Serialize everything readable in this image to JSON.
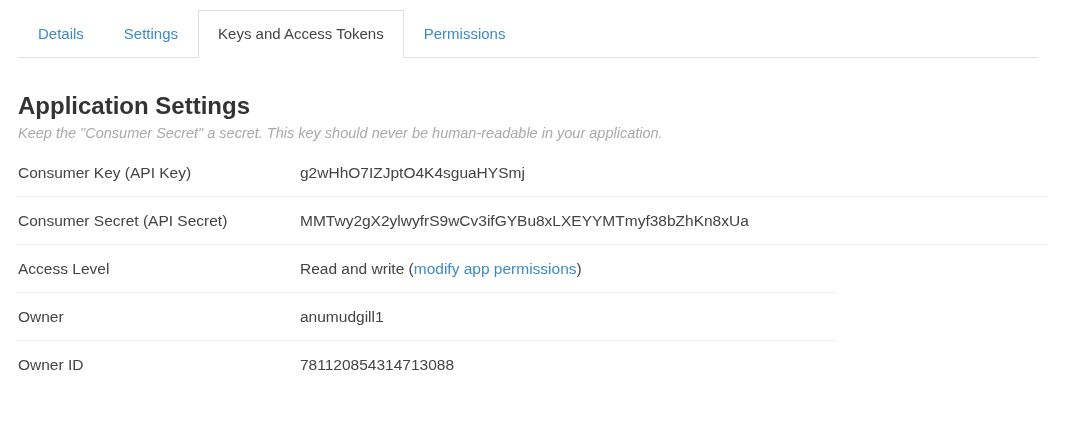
{
  "tabs": [
    {
      "label": "Details",
      "selected": false
    },
    {
      "label": "Settings",
      "selected": false
    },
    {
      "label": "Keys and Access Tokens",
      "selected": true
    },
    {
      "label": "Permissions",
      "selected": false
    }
  ],
  "heading": "Application Settings",
  "note": "Keep the \"Consumer Secret\" a secret. This key should never be human-readable in your application.",
  "rows": [
    {
      "label": "Consumer Key (API Key)",
      "value": "g2wHhO7IZJptO4K4sguaHYSmj"
    },
    {
      "label": "Consumer Secret (API Secret)",
      "value": "MMTwy2gX2ylwyfrS9wCv3ifGYBu8xLXEYYMTmyf38bZhKn8xUa"
    },
    {
      "label": "Access Level",
      "value": "Read and write (",
      "link": "modify app permissions",
      "after": ")"
    },
    {
      "label": "Owner",
      "value": "anumudgill1"
    },
    {
      "label": "Owner ID",
      "value": "781120854314713088"
    }
  ]
}
